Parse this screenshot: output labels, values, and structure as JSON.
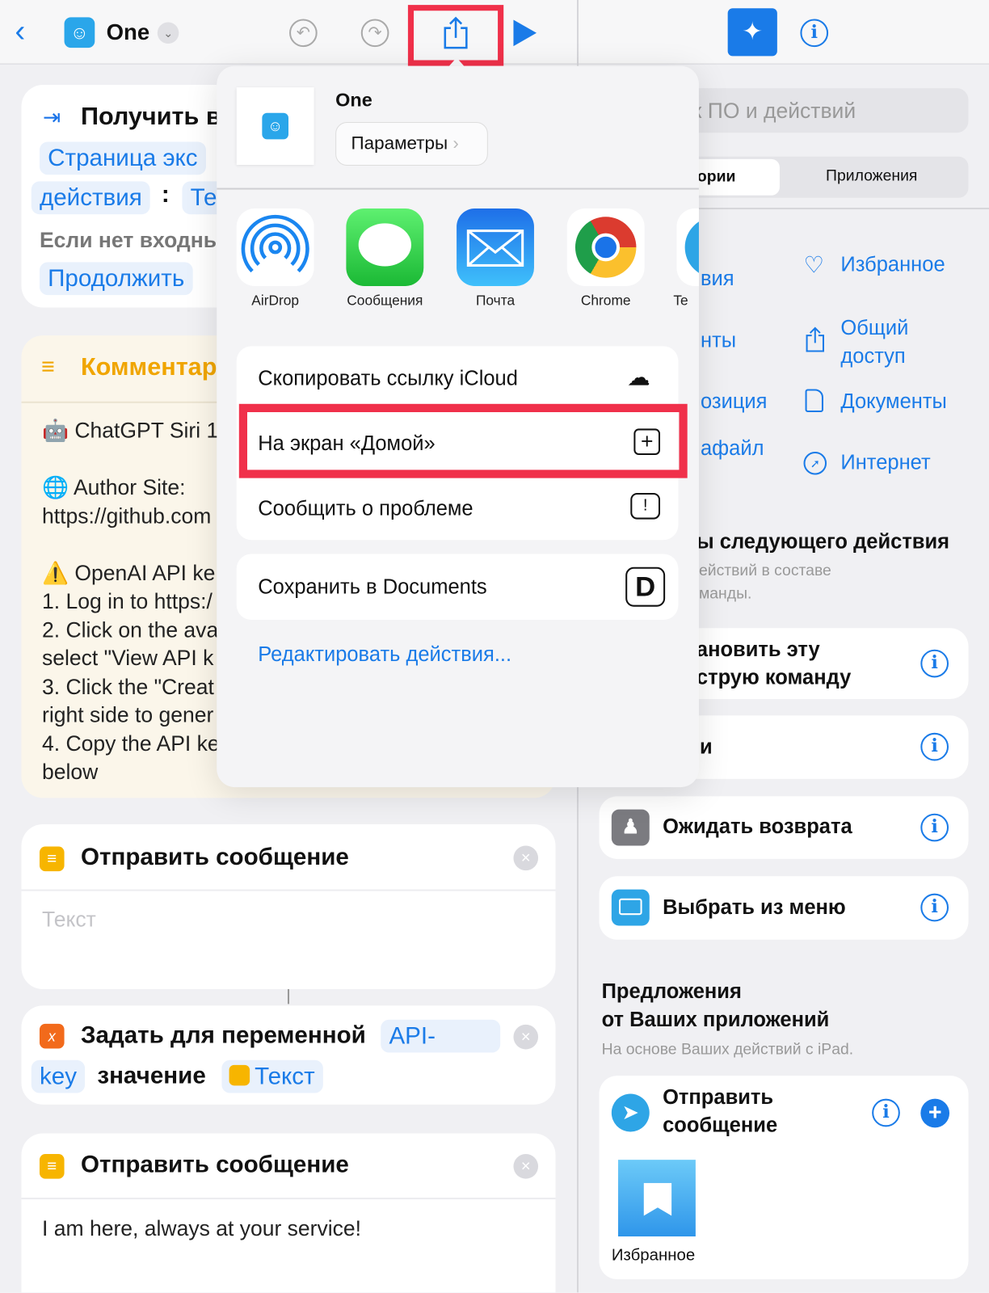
{
  "topbar": {
    "title": "One",
    "icons": [
      "chevron-left-icon",
      "shortcut-robot-icon",
      "chevron-down-icon",
      "undo-icon",
      "redo-icon",
      "share-icon",
      "play-icon",
      "action-library-icon",
      "info-icon"
    ],
    "highlight_color": "#f0304a",
    "accent": "#1a7be8"
  },
  "editor": {
    "get_input": {
      "title": "Получить в",
      "pill1": "Страница экс",
      "pill2": "действия",
      "colon": ":",
      "pill3": "Те",
      "if_none": "Если нет входны",
      "continue": "Продолжить"
    },
    "comment": {
      "title": "Комментар",
      "lines": [
        "🤖 ChatGPT Siri 1",
        "",
        "🌐 Author Site:",
        "https://github.com",
        "",
        "⚠️ OpenAI API ke",
        "1. Log in to https:/",
        "2. Click on the ava",
        "select \"View API k",
        "3. Click the \"Creat",
        "right side to gener",
        "4. Copy the API ke",
        "below"
      ]
    },
    "send_message_1": {
      "title": "Отправить сообщение",
      "placeholder": "Текст"
    },
    "set_variable": {
      "title": "Задать для переменной",
      "var1": "API-",
      "var2": "key",
      "value_label": "значение",
      "value": "Текст"
    },
    "send_message_2": {
      "title": "Отправить сообщение",
      "text": "I am here, always at your service!"
    }
  },
  "share_sheet": {
    "name": "One",
    "options_button": "Параметры",
    "apps": [
      {
        "label": "AirDrop",
        "icon": "airdrop-icon"
      },
      {
        "label": "Сообщения",
        "icon": "messages-icon"
      },
      {
        "label": "Почта",
        "icon": "mail-icon"
      },
      {
        "label": "Chrome",
        "icon": "chrome-icon"
      },
      {
        "label": "Te",
        "icon": "telegram-icon"
      }
    ],
    "actions": [
      {
        "label": "Скопировать ссылку iCloud",
        "icon": "icloud-link-icon"
      },
      {
        "label": "На экран «Домой»",
        "icon": "add-square-icon",
        "highlighted": true
      },
      {
        "label": "Сообщить о проблеме",
        "icon": "report-bubble-icon"
      }
    ],
    "actions2": [
      {
        "label": "Сохранить в Documents",
        "icon": "documents-app-icon"
      }
    ],
    "edit_actions": "Редактировать действия..."
  },
  "sidebar": {
    "search_placeholder": "к ПО и действий",
    "segments": [
      "ории",
      "Приложения"
    ],
    "categories_left": [
      "вия",
      "нты",
      "озиция",
      "афайл"
    ],
    "categories_right": [
      {
        "label": "Избранное",
        "icon": "heart-icon"
      },
      {
        "label": "Общий доступ",
        "icon": "share-icon"
      },
      {
        "label": "Документы",
        "icon": "document-icon"
      },
      {
        "label": "Интернет",
        "icon": "compass-icon"
      }
    ],
    "next_heading": "ы следующего действия",
    "next_sub1": "ействий в составе",
    "next_sub2": "манды.",
    "next_actions": [
      {
        "line1": "ановить эту",
        "line2": "струю команду"
      },
      {
        "line1": "и"
      },
      {
        "line1": "Ожидать возврата",
        "icon": "wait-return-icon"
      },
      {
        "line1": "Выбрать из меню",
        "icon": "menu-icon"
      }
    ],
    "suggestions_title1": "Предложения",
    "suggestions_title2": "от Ваших приложений",
    "suggestions_sub": "На основе Ваших действий с iPad.",
    "suggestion": {
      "line1": "Отправить",
      "line2": "сообщение",
      "app_icon": "telegram-icon",
      "tile_label": "Избранное"
    }
  }
}
